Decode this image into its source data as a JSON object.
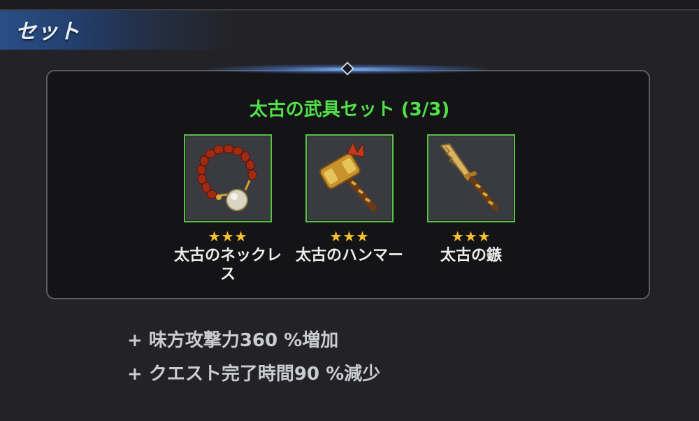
{
  "header": {
    "title": "セット"
  },
  "set": {
    "title": "太古の武具セット (3/3)",
    "items": [
      {
        "name": "太古のネックレス",
        "stars": "★★★",
        "icon": "necklace-icon"
      },
      {
        "name": "太古のハンマー",
        "stars": "★★★",
        "icon": "hammer-icon"
      },
      {
        "name": "太古の鏃",
        "stars": "★★★",
        "icon": "blade-icon"
      }
    ]
  },
  "bonuses": [
    "+ 味方攻撃力360 %増加",
    "+ クエスト完了時間90 %減少"
  ],
  "colors": {
    "set_title": "#52e04b",
    "frame_border": "#58c049",
    "star": "#f2c233"
  }
}
